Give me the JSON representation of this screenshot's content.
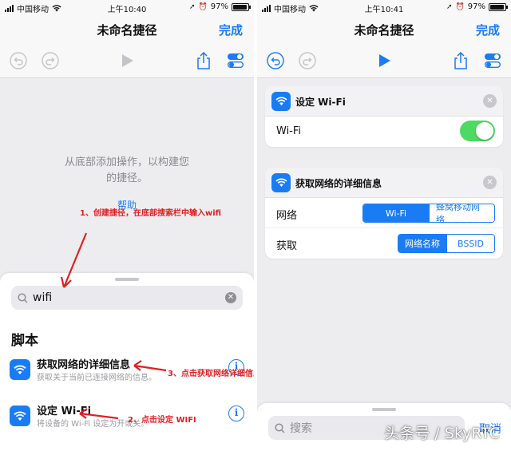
{
  "left_screen": {
    "status": {
      "carrier": "中国移动",
      "time": "上午10:40",
      "battery": "97%",
      "battery_level": 0.97
    },
    "nav": {
      "title": "未命名捷径",
      "done": "完成"
    },
    "hint": [
      "从底部添加操作，以构建您",
      "的捷径。"
    ],
    "help": "帮助",
    "sheet": {
      "search_value": "wifi",
      "section": "脚本",
      "actions": [
        {
          "title": "获取网络的详细信息",
          "subtitle": "获取关于当前已连接网络的信息。"
        },
        {
          "title": "设定 Wi-Fi",
          "subtitle": "将设备的 Wi-Fi 设定为开或关。"
        }
      ]
    },
    "annotations": {
      "step1": "1、创建捷径，在底部搜索栏中输入wifi",
      "step2": "2、点击设定 WIFI",
      "step3": "3、点击获取网络详细信息"
    }
  },
  "right_screen": {
    "status": {
      "carrier": "中国移动",
      "time": "上午10:41",
      "battery": "97%",
      "battery_level": 0.97
    },
    "nav": {
      "title": "未命名捷径",
      "done": "完成"
    },
    "card_wifi": {
      "title": "设定 Wi-Fi",
      "row_label": "Wi-Fi",
      "toggle_on": true
    },
    "card_network": {
      "title": "获取网络的详细信息",
      "rows": [
        {
          "label": "网络",
          "options": [
            "Wi-Fi",
            "蜂窝移动网络"
          ],
          "selected": 0
        },
        {
          "label": "获取",
          "options": [
            "网络名称",
            "BSSID"
          ],
          "selected": 0
        }
      ]
    },
    "sheet": {
      "search_placeholder": "搜索",
      "cancel": "取消"
    }
  },
  "watermark": "头条号 / SkyRTC",
  "colors": {
    "accent": "#1a7cf5",
    "toggle_on": "#4cd964",
    "annotation": "#e02020"
  }
}
